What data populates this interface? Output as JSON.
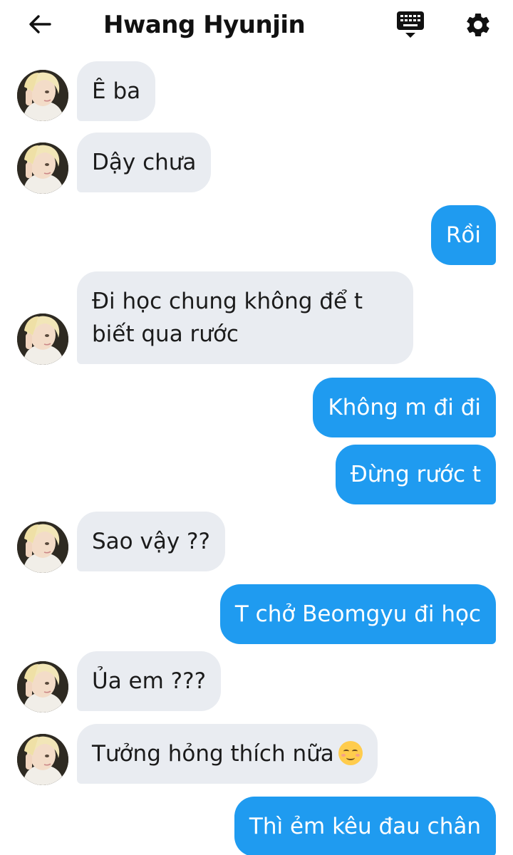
{
  "header": {
    "title": "Hwang Hyunjin",
    "back_icon": "arrow-left-icon",
    "keyboard_icon": "keyboard-icon",
    "settings_icon": "gear-icon"
  },
  "colors": {
    "incoming_bubble": "#e9ecf1",
    "outgoing_bubble": "#1f9bf0"
  },
  "messages": [
    {
      "from": "contact",
      "text": "Ê ba"
    },
    {
      "from": "contact",
      "text": "Dậy chưa"
    },
    {
      "from": "me",
      "text": "Rồi"
    },
    {
      "from": "contact",
      "text": "Đi học chung không để t biết qua rước"
    },
    {
      "from": "me",
      "text": "Không m đi đi"
    },
    {
      "from": "me",
      "text": "Đừng rước t"
    },
    {
      "from": "contact",
      "text": "Sao vậy ??"
    },
    {
      "from": "me",
      "text": "T chở Beomgyu đi học"
    },
    {
      "from": "contact",
      "text": "Ủa em ???"
    },
    {
      "from": "contact",
      "text": "Tưởng hỏng thích nữa",
      "emoji": "relieved-face-emoji"
    },
    {
      "from": "me",
      "text": "Thì ẻm kêu đau chân"
    }
  ]
}
